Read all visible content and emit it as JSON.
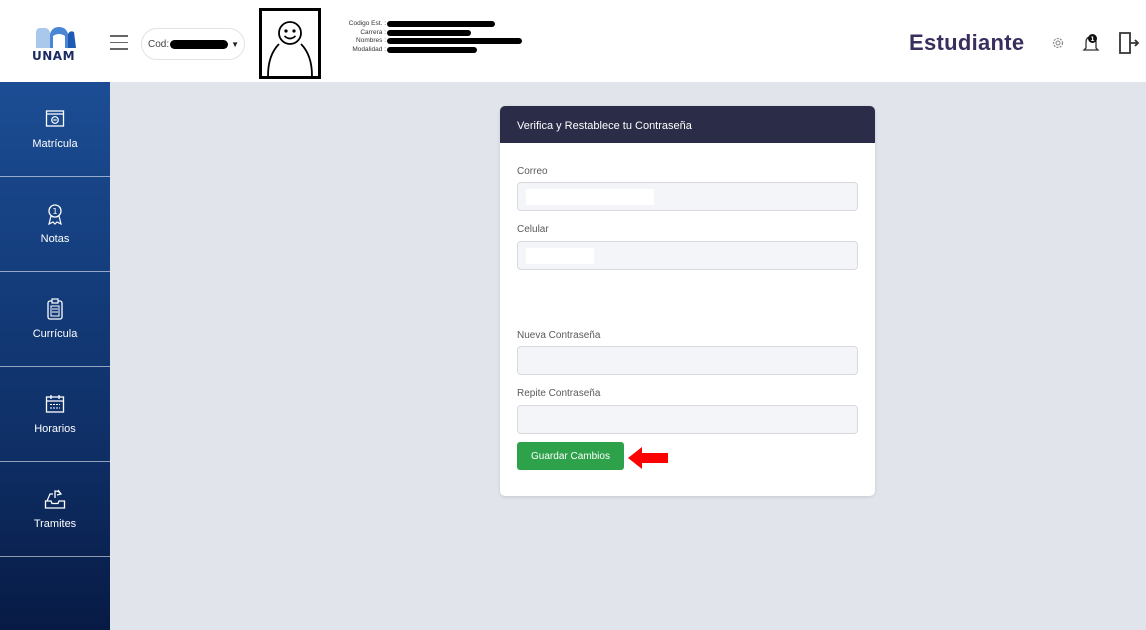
{
  "header": {
    "logo_text": "UNAM",
    "cod_label": "Cod:",
    "info_labels": [
      "Codigo Est. :",
      "Carrera :",
      "Nombres :",
      "Modalidad :"
    ],
    "role_title": "Estudiante",
    "icons": [
      "menu-icon",
      "settings-icon",
      "notification-icon",
      "logout-icon"
    ]
  },
  "sidebar": {
    "items": [
      {
        "label": "Matrícula",
        "icon": "enrollment-icon"
      },
      {
        "label": "Notas",
        "icon": "award-icon"
      },
      {
        "label": "Currícula",
        "icon": "clipboard-icon"
      },
      {
        "label": "Horarios",
        "icon": "calendar-icon"
      },
      {
        "label": "Tramites",
        "icon": "inbox-upload-icon"
      }
    ]
  },
  "form": {
    "title": "Verifica y Restablece tu Contraseña",
    "correo_label": "Correo",
    "celular_label": "Celular",
    "nueva_label": "Nueva Contraseña",
    "repite_label": "Repite Contraseña",
    "save_label": "Guardar Cambios"
  },
  "colors": {
    "accent_green": "#2ea24a",
    "card_header": "#2a2c48",
    "sidebar_top": "#1c4d94",
    "sidebar_bottom": "#071a44",
    "annotation_arrow": "#ff0000"
  }
}
